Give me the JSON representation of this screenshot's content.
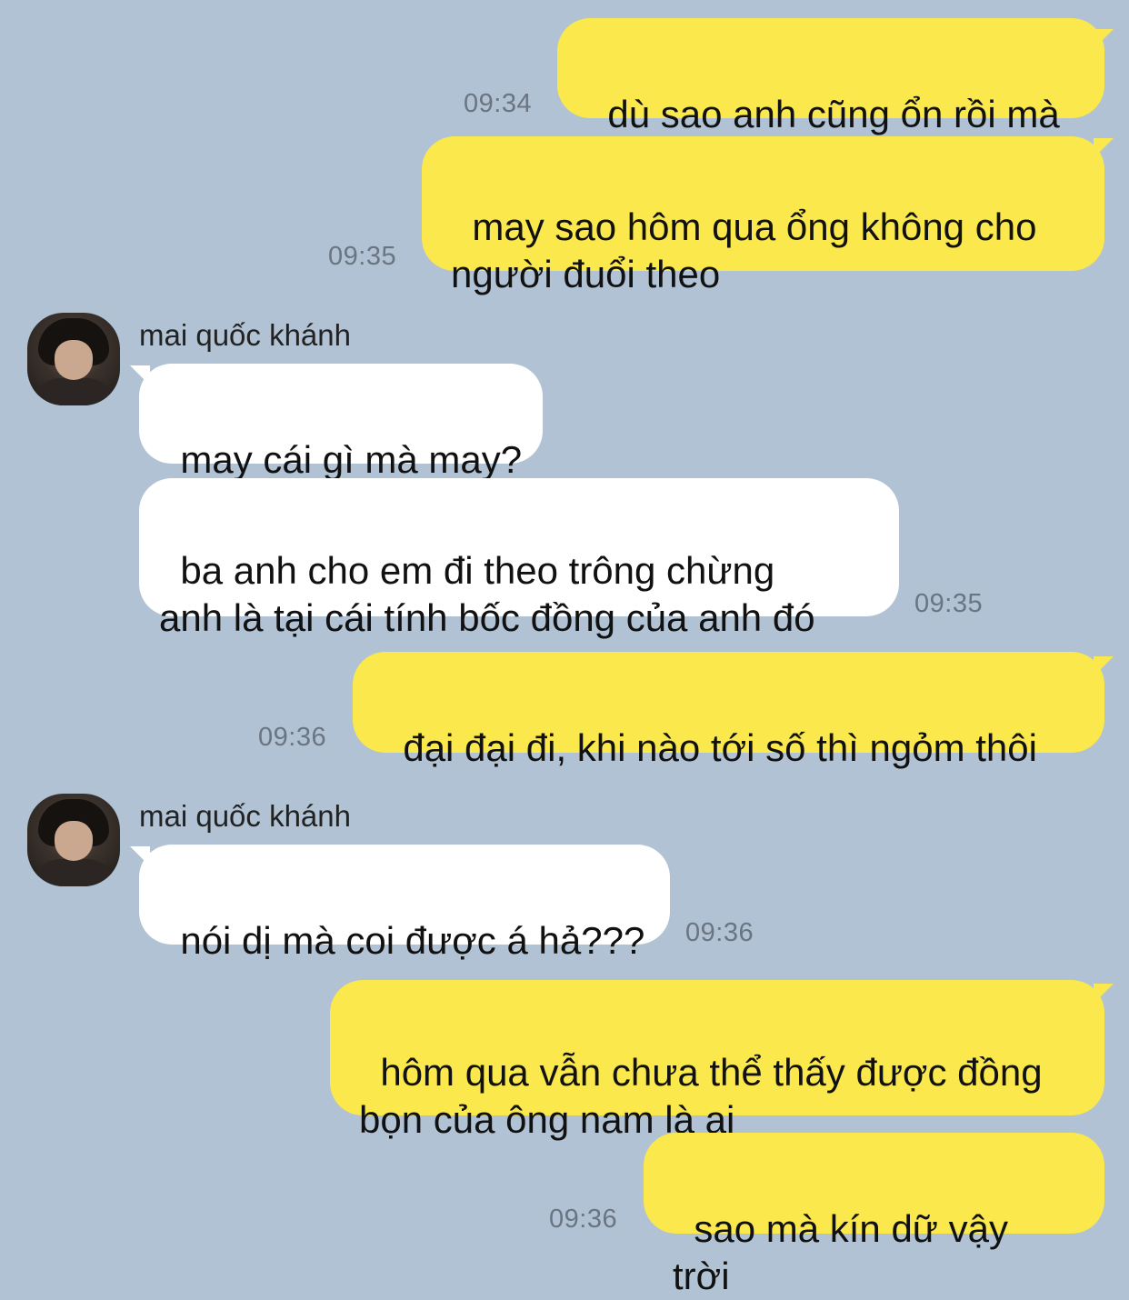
{
  "contact": {
    "name": "mai quốc khánh"
  },
  "messages": [
    {
      "from": "me",
      "text": "dù sao anh cũng ổn rồi mà",
      "time": "09:34"
    },
    {
      "from": "me",
      "text": "may sao hôm qua ổng không cho\nngười đuổi theo",
      "time": "09:35"
    },
    {
      "from": "them",
      "sender": "mai quốc khánh",
      "text": "may cái gì mà may?",
      "time": ""
    },
    {
      "from": "them",
      "text": "ba anh cho em đi theo trông chừng\nanh là tại cái tính bốc đồng của anh đó",
      "time": "09:35"
    },
    {
      "from": "me",
      "text": "đại đại đi, khi nào tới số thì ngỏm thôi",
      "time": "09:36"
    },
    {
      "from": "them",
      "sender": "mai quốc khánh",
      "text": "nói dị mà coi được á hả???",
      "time": "09:36"
    },
    {
      "from": "me",
      "text": "hôm qua vẫn chưa thể thấy được đồng\nbọn của ông nam là ai",
      "time": ""
    },
    {
      "from": "me",
      "text": "sao mà kín dữ vậy trời",
      "time": "09:36"
    }
  ],
  "colors": {
    "background": "#b0c2d3",
    "my_bubble": "#fae84c",
    "their_bubble": "#ffffff",
    "timestamp": "#6b7582"
  }
}
